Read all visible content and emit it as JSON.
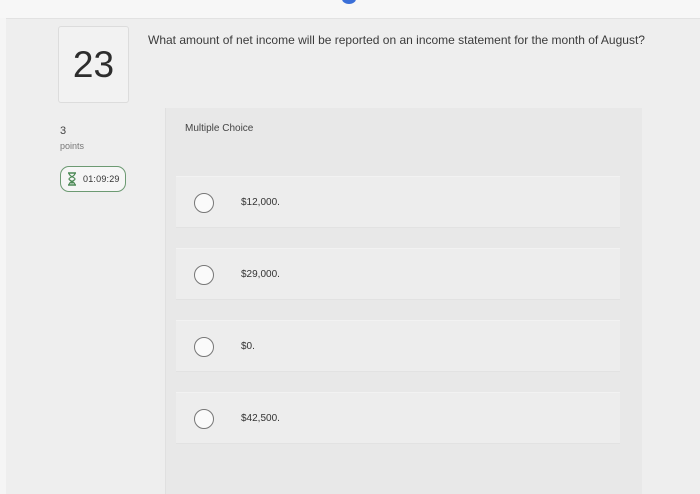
{
  "question": {
    "number": "23",
    "text": "What amount of net income will be reported on an income statement for the month of August?"
  },
  "meta": {
    "points_value": "3",
    "points_label": "points",
    "timer": "01:09:29"
  },
  "choices": {
    "header": "Multiple Choice",
    "options": [
      {
        "label": "$12,000."
      },
      {
        "label": "$29,000."
      },
      {
        "label": "$0."
      },
      {
        "label": "$42,500."
      }
    ]
  },
  "colors": {
    "timer_border": "#6c9a72",
    "top_dot": "#3a6fd8"
  },
  "icons": {
    "timer": "hourglass-icon",
    "radio": "radio-button-icon"
  }
}
